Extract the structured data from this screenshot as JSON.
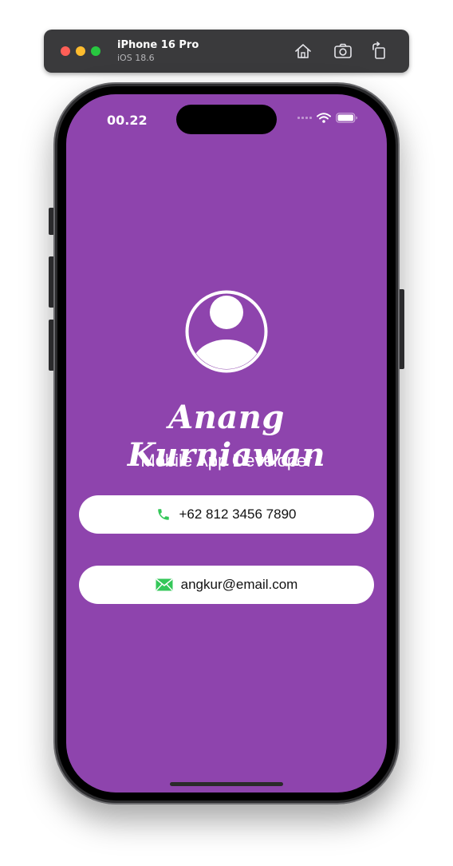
{
  "simulator": {
    "device_name": "iPhone 16 Pro",
    "os_version": "iOS 18.6",
    "toolbar_icons": [
      "home-icon",
      "screenshot-icon",
      "rotate-icon"
    ]
  },
  "status_bar": {
    "time": "00.22",
    "icons": [
      "wifi-icon",
      "battery-icon"
    ]
  },
  "profile": {
    "avatar_icon": "person-circle-icon",
    "name": "Anang Kurniawan",
    "title": "Mobile App Developer"
  },
  "contacts": {
    "phone": {
      "icon": "phone-icon",
      "value": "+62 812 3456 7890"
    },
    "email": {
      "icon": "envelope-icon",
      "value": "angkur@email.com"
    }
  },
  "colors": {
    "background": "#8e44ad",
    "card": "#ffffff",
    "icon_accent": "#34c759"
  }
}
